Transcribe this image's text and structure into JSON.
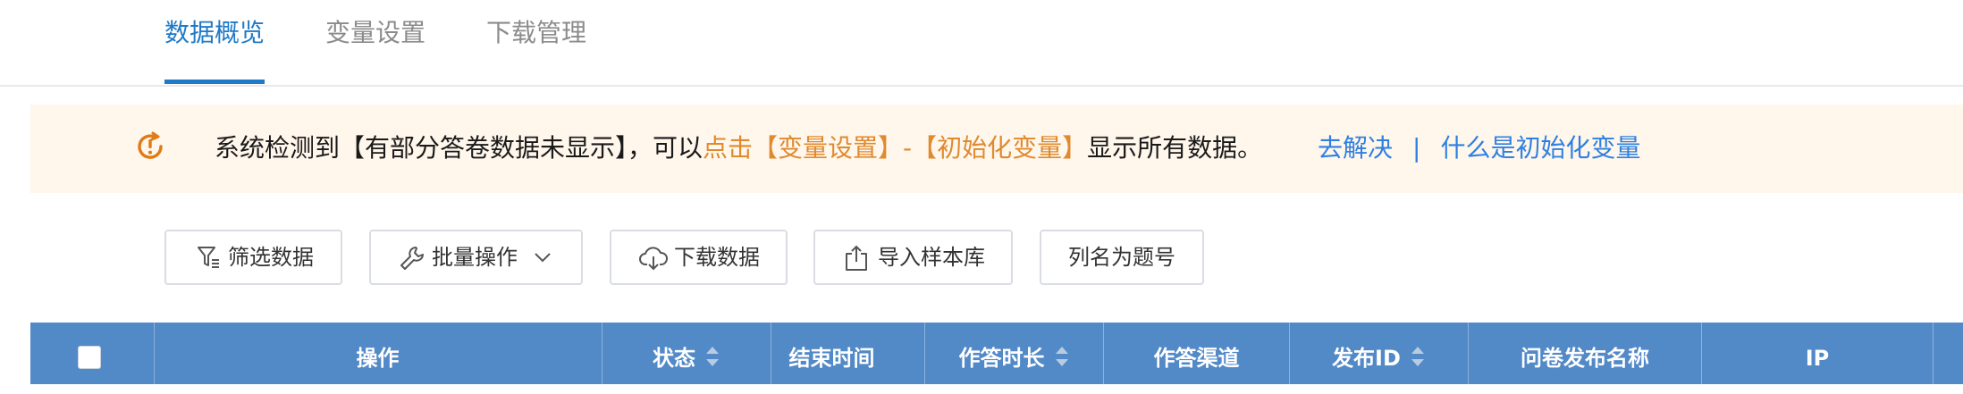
{
  "tabs": [
    {
      "label": "数据概览"
    },
    {
      "label": "变量设置"
    },
    {
      "label": "下载管理"
    }
  ],
  "notice": {
    "text_prefix": "系统检测到【有部分答卷数据未显示】，可以",
    "text_highlight": "点击【变量设置】-【初始化变量】",
    "text_suffix": "显示所有数据。",
    "link_resolve": "去解决",
    "separator": "|",
    "link_what": "什么是初始化变量",
    "icon": "warning-clock-icon"
  },
  "toolbar": {
    "filter": "筛选数据",
    "batch": "批量操作",
    "download": "下载数据",
    "import": "导入样本库",
    "column_as_title": "列名为题号"
  },
  "table": {
    "headers": [
      "操作",
      "状态",
      "结束时间",
      "作答时长",
      "作答渠道",
      "发布ID",
      "问卷发布名称",
      "IP"
    ]
  },
  "colors": {
    "accent": "#1f7ac7",
    "header_bg": "#5289c7",
    "notice_bg": "#fff6ec",
    "notice_highlight": "#e08a2e",
    "link": "#2f80e0"
  }
}
